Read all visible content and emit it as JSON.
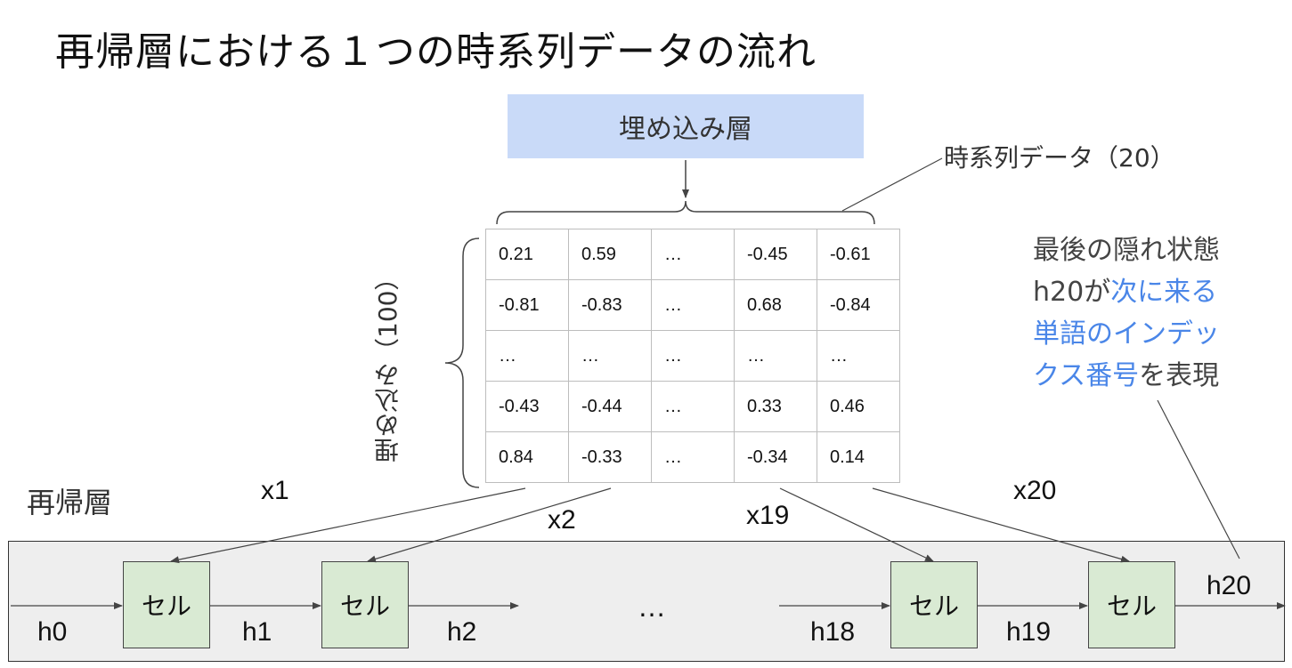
{
  "title": "再帰層における１つの時系列データの流れ",
  "embedding_layer": "埋め込み層",
  "timeseries_label": "時系列データ（20）",
  "embedding_dim_label": "埋め込み（100）",
  "matrix": [
    [
      "0.21",
      "0.59",
      "…",
      "-0.45",
      "-0.61"
    ],
    [
      "-0.81",
      "-0.83",
      "…",
      "0.68",
      "-0.84"
    ],
    [
      "…",
      "…",
      "…",
      "…",
      "…"
    ],
    [
      "-0.43",
      "-0.44",
      "…",
      "0.33",
      "0.46"
    ],
    [
      "0.84",
      "-0.33",
      "…",
      "-0.34",
      "0.14"
    ]
  ],
  "note": {
    "line1": "最後の隠れ状態",
    "line2_a": "h20が",
    "line2_b": "次に来る",
    "line3": "単語のインデッ",
    "line4_a": "クス番号",
    "line4_b": "を表現",
    "highlight_color": "#4a86e8"
  },
  "rnn_layer_label": "再帰層",
  "cell_label": "セル",
  "inputs": {
    "x1": "x1",
    "x2": "x2",
    "x19": "x19",
    "x20": "x20"
  },
  "hidden": {
    "h0": "h0",
    "h1": "h1",
    "h2": "h2",
    "h18": "h18",
    "h19": "h19",
    "h20": "h20"
  },
  "ellipsis": "…"
}
